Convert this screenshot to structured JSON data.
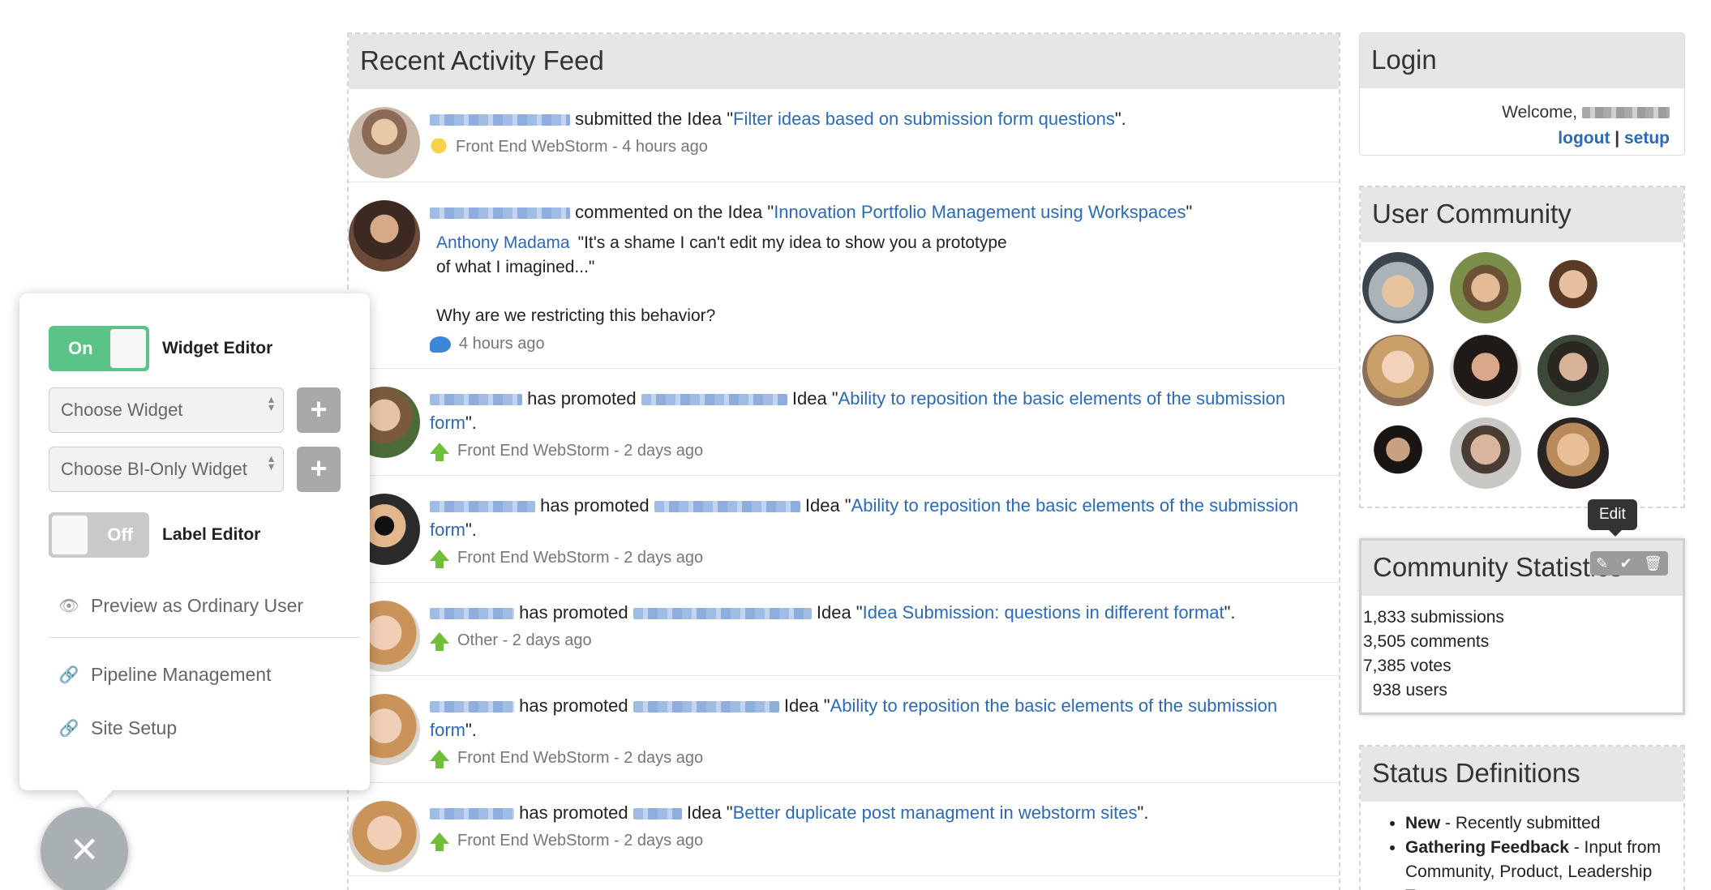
{
  "feed": {
    "title": "Recent Activity Feed",
    "items": [
      {
        "type": "submitted",
        "actor_width": 173,
        "action": " submitted the Idea \"",
        "idea": "Filter ideas based on submission form questions",
        "closing": "\".",
        "icon": "lightbulb-icon",
        "meta": "Front End WebStorm - 4 hours ago"
      },
      {
        "type": "commented",
        "action": " commented on the Idea \"",
        "idea": "Innovation Portfolio Management using Workspaces",
        "closing": "\"",
        "comment_author": "Anthony Madama",
        "comment_text": "\"It's a shame I can't edit my idea to show you a prototype\nof what I imagined...\"\n\nWhy are we restricting this behavior?",
        "icon": "speech-bubble-icon",
        "meta": "4 hours ago"
      },
      {
        "type": "promoted",
        "action": " has promoted ",
        "idea_prefix": " Idea \"",
        "idea": "Ability to reposition the basic elements of the submission form",
        "closing": "\".",
        "icon": "promote-arrow-icon",
        "meta": "Front End WebStorm - 2 days ago"
      },
      {
        "type": "promoted",
        "action": " has promoted ",
        "idea_prefix": " Idea \"",
        "idea": "Ability to reposition the basic elements of the submission form",
        "closing": "\".",
        "icon": "promote-arrow-icon",
        "meta": "Front End WebStorm - 2 days ago"
      },
      {
        "type": "promoted",
        "action": " has promoted ",
        "idea_prefix": " Idea \"",
        "idea": "Idea Submission: questions in different format",
        "closing": "\".",
        "icon": "promote-arrow-icon",
        "meta": "Other - 2 days ago"
      },
      {
        "type": "promoted",
        "action": " has promoted ",
        "idea_prefix": " Idea \"",
        "idea": "Ability to reposition the basic elements of the submission form",
        "closing": "\".",
        "icon": "promote-arrow-icon",
        "meta": "Front End WebStorm - 2 days ago"
      },
      {
        "type": "promoted",
        "action": " has promoted ",
        "idea_prefix": " Idea \"",
        "idea": "Better duplicate post managment in webstorm sites",
        "closing": "\".",
        "icon": "promote-arrow-icon",
        "meta": "Front End WebStorm - 2 days ago"
      }
    ]
  },
  "login": {
    "title": "Login",
    "welcome": "Welcome,",
    "logout": "logout",
    "separator": " | ",
    "setup": "setup"
  },
  "community": {
    "title": "User Community",
    "avatar_count": 9
  },
  "stats": {
    "title": "Community Statistics",
    "tooltip": "Edit",
    "lines": [
      "1,833 submissions",
      "3,505 comments",
      "7,385 votes",
      "  938 users"
    ]
  },
  "status": {
    "title": "Status Definitions",
    "items": [
      {
        "name": "New",
        "desc": " - Recently submitted"
      },
      {
        "name": "Gathering Feedback",
        "desc": " - Input from Community, Product, Leadership Team"
      }
    ]
  },
  "editor": {
    "widget_toggle": {
      "state": "On",
      "label": "Widget Editor"
    },
    "choose_widget": "Choose Widget",
    "choose_bi_widget": "Choose BI-Only Widget",
    "label_toggle": {
      "state": "Off",
      "label": "Label Editor"
    },
    "preview": "Preview as Ordinary User",
    "pipeline": "Pipeline Management",
    "site_setup": "Site Setup",
    "plus": "+",
    "close": "×"
  },
  "colors": {
    "link": "#2a6ab8",
    "toggle_on": "#59c486",
    "toggle_off": "#c9c9c9",
    "panel_header": "#e6e6e6"
  }
}
